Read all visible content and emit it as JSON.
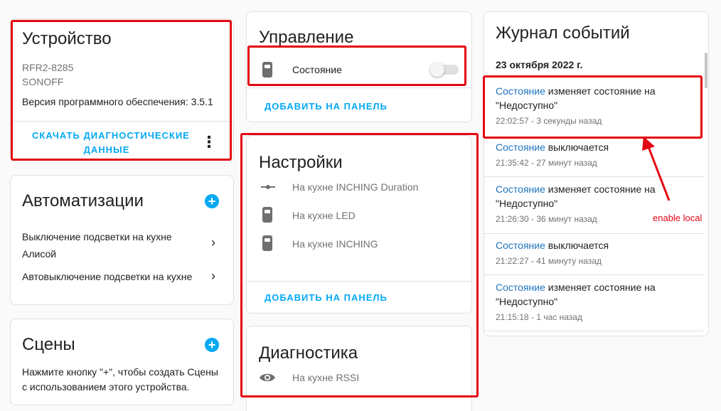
{
  "device": {
    "title": "Устройство",
    "model": "RFR2-8285",
    "manufacturer": "SONOFF",
    "firmware": "Версия программного обеспечения: 3.5.1",
    "download_diag_line1": "СКАЧАТЬ ДИАГНОСТИЧЕСКИЕ",
    "download_diag_line2": "ДАННЫЕ",
    "more_icon": "⋮"
  },
  "automations": {
    "title": "Автоматизации",
    "items": [
      {
        "line1": "Выключение подсветки на кухне",
        "line2": "Алисой"
      },
      {
        "line1": "Автовыключение подсветки на кухне"
      }
    ]
  },
  "scenes": {
    "title": "Сцены",
    "hint_line1": "Нажмите кнопку \"+\", чтобы создать Сцены",
    "hint_line2": "с использованием этого устройства."
  },
  "controls": {
    "title": "Управление",
    "entity": "Состояние",
    "toggle_on": false,
    "add_to_panel": "ДОБАВИТЬ НА ПАНЕЛЬ"
  },
  "settings": {
    "title": "Настройки",
    "items": [
      {
        "label": "На кухне INCHING Duration",
        "icon": "slider-icon"
      },
      {
        "label": "На кухне LED",
        "icon": "switch-icon"
      },
      {
        "label": "На кухне INCHING",
        "icon": "switch-icon"
      }
    ],
    "add_to_panel": "ДОБАВИТЬ НА ПАНЕЛЬ"
  },
  "diagnostics": {
    "title": "Диагностика",
    "items": [
      {
        "label": "На кухне RSSI",
        "icon": "eye-icon"
      }
    ]
  },
  "logbook": {
    "title": "Журнал событий",
    "date": "23 октября 2022 г.",
    "entries": [
      {
        "entity": "Состояние",
        "line1": " изменяет состояние на",
        "line2": "\"Недоступно\"",
        "time": "22:02:57 - 3 секунды назад"
      },
      {
        "entity": "Состояние",
        "line1": " выключается",
        "time": "21:35:42 - 27 минут назад"
      },
      {
        "entity": "Состояние",
        "line1": " изменяет состояние на",
        "line2": "\"Недоступно\"",
        "time": "21:26:30 - 36 минут назад"
      },
      {
        "entity": "Состояние",
        "line1": " выключается",
        "time": "21:22:27 - 41 минуту назад"
      },
      {
        "entity": "Состояние",
        "line1": " изменяет состояние на",
        "line2": "\"Недоступно\"",
        "time": "21:15:18 - 1 час назад"
      }
    ]
  },
  "annotation": {
    "text": "enable local",
    "color": "#e30613"
  },
  "colors": {
    "accent": "#03a9f4",
    "link": "#1e73be",
    "highlight": "#e30613"
  }
}
